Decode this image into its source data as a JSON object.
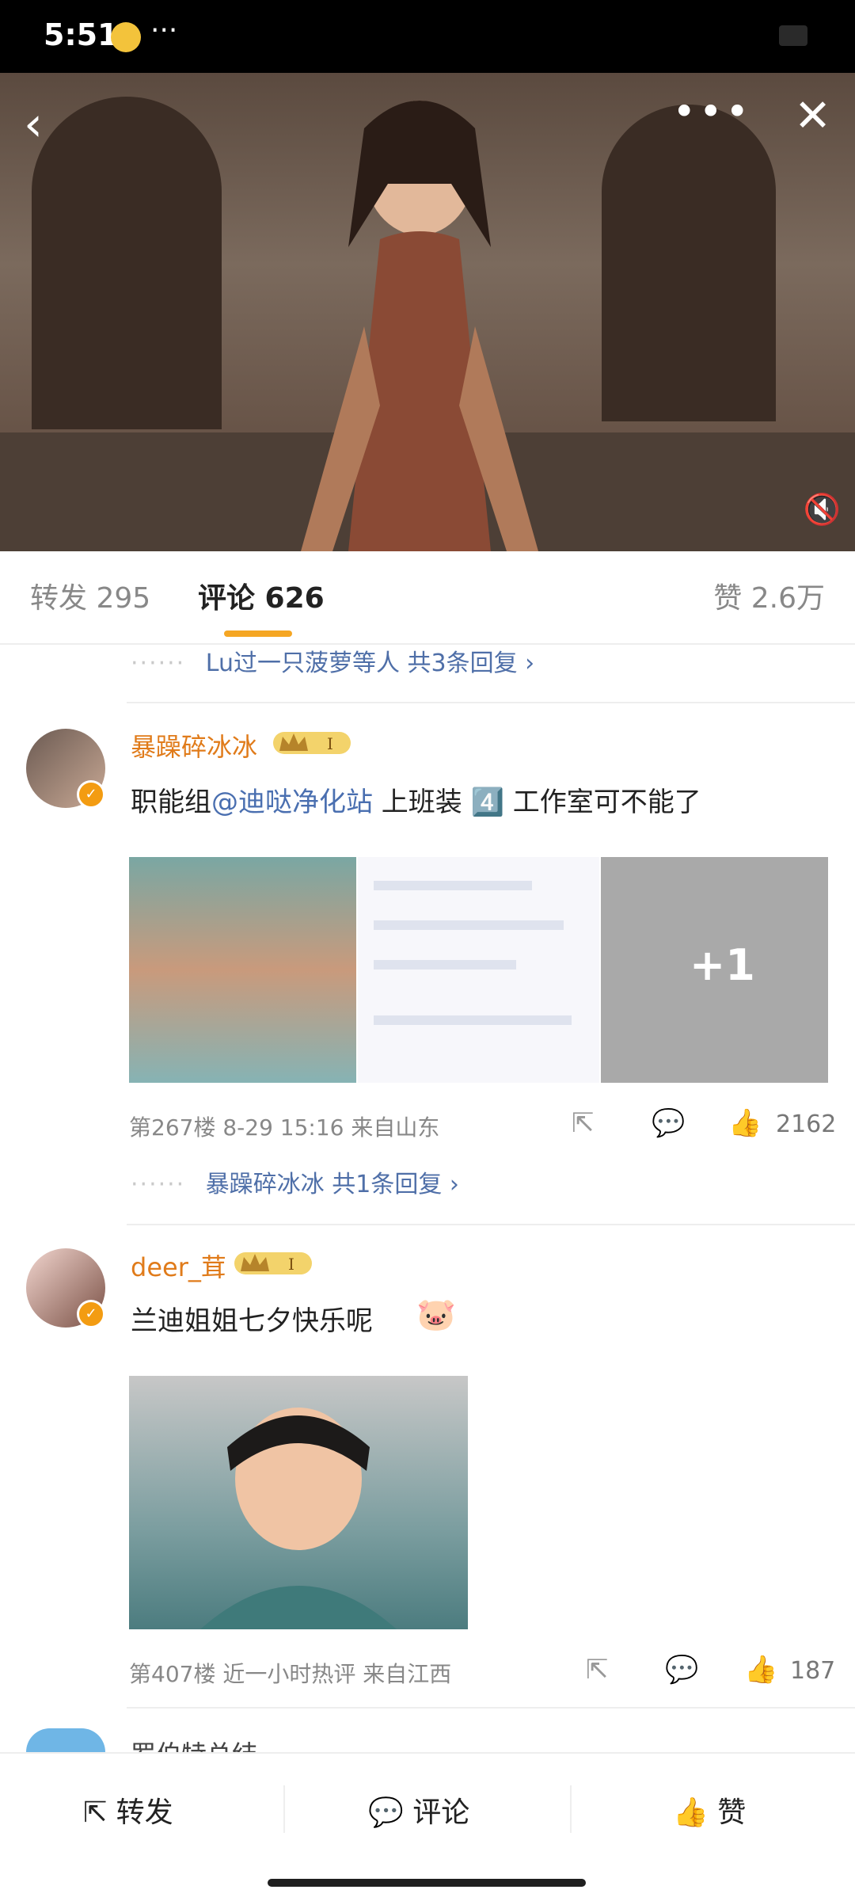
{
  "status": {
    "time": "5:51"
  },
  "video": {
    "icons": [
      "back-icon",
      "more-icon",
      "close-icon",
      "mute-icon"
    ]
  },
  "tabs": {
    "forward": "转发 295",
    "comment": "评论 626",
    "like": "赞 2.6万"
  },
  "top_reply": {
    "text": "Lu过一只菠萝等人  共3条回复 ›"
  },
  "comments": [
    {
      "username": "暴躁碎冰冰",
      "text_before": "职能组",
      "mention": "@迪哒净化站",
      "text_after": " 上班装 4️⃣ 工作室可不能了",
      "images_more": "+1",
      "meta": "第267楼  8-29 15:16  来自山东",
      "likes": "2162",
      "reply_row": "暴躁碎冰冰  共1条回复 ›"
    },
    {
      "username": "deer_茸",
      "text": "兰迪姐姐七夕快乐呢",
      "meta": "第407楼  近一小时热评  来自江西",
      "likes": "187"
    },
    {
      "username": "罗伯特总结"
    }
  ],
  "bottom": {
    "forward": "转发",
    "comment": "评论",
    "like": "赞"
  },
  "colors": {
    "accent": "#f5a623",
    "link": "#4a6fb0",
    "username": "#e07b1a"
  }
}
